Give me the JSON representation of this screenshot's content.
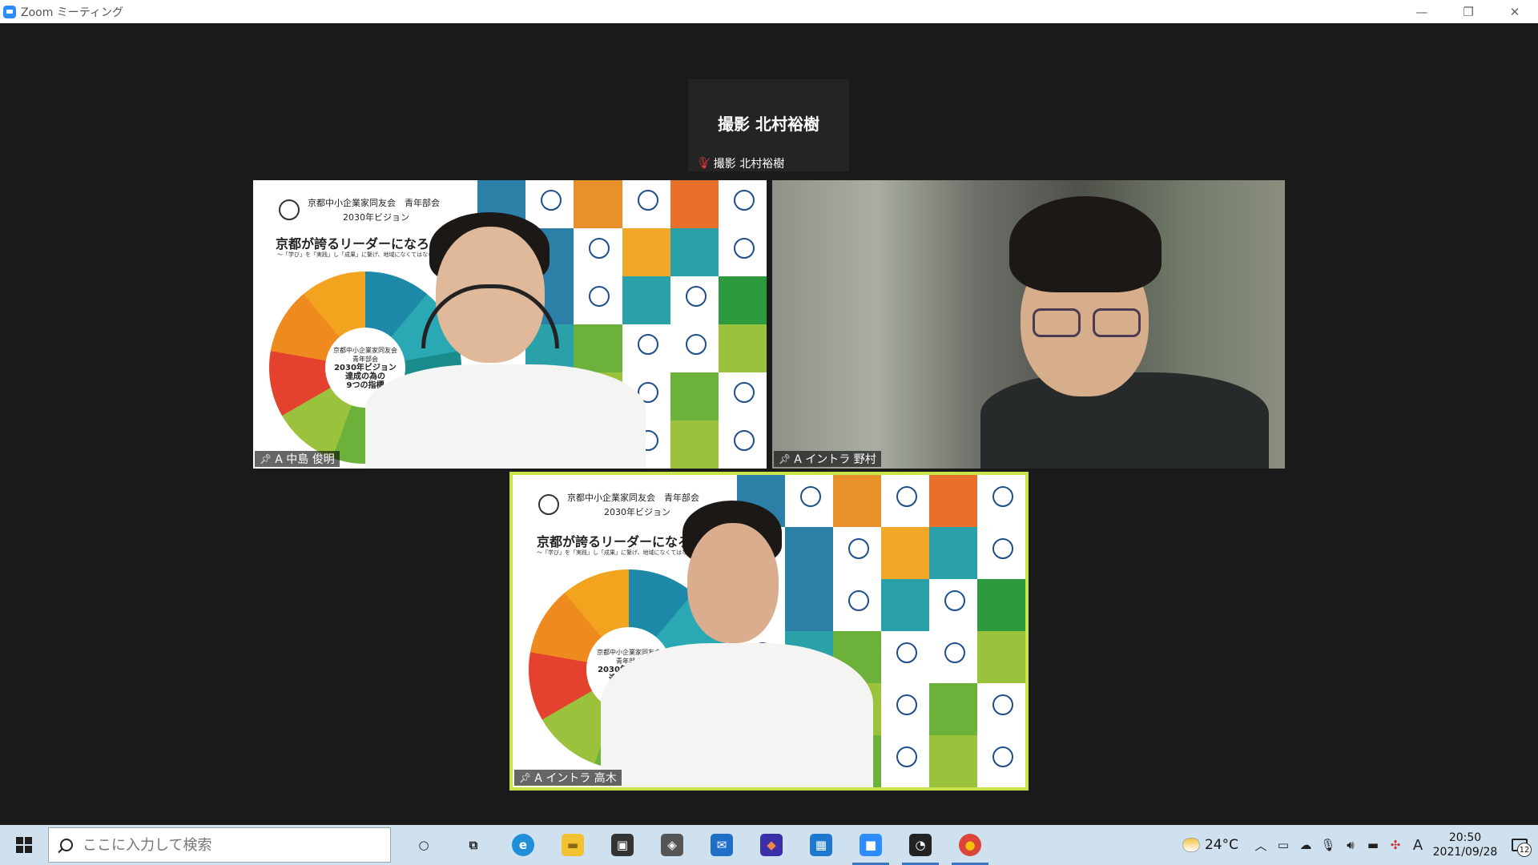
{
  "window": {
    "title": "Zoom ミーティング"
  },
  "participants": [
    {
      "id": "top",
      "display_name": "撮影 北村裕樹",
      "tag": "撮影 北村裕樹",
      "muted": true
    },
    {
      "id": "p1",
      "tag": "A 中島 俊明"
    },
    {
      "id": "p2",
      "tag": "A イントラ 野村"
    },
    {
      "id": "p3",
      "tag": "A イントラ 高木"
    }
  ],
  "slide": {
    "org": "京都中小企業家同友会　青年部会",
    "vision": "2030年ビジョン",
    "slogan": "京都が誇るリーダーになろう",
    "sub": "〜「学び」を「実践」し「成果」に繋げ、地域になくてはならない経営者へ〜",
    "hub_lines": [
      "京都中小企業家同友会",
      "青年部会",
      "2030年ビジョン",
      "達成の為の",
      "9つの指標"
    ],
    "grid_colors": [
      "#2c7fa6",
      "#ffffff",
      "#e8912a",
      "#ffffff",
      "#e8702a",
      "#ffffff",
      "#ffffff",
      "#2c7fa6",
      "#ffffff",
      "#f0a72a",
      "#2aa0a8",
      "#ffffff",
      "#ffffff",
      "#2c7fa6",
      "#ffffff",
      "#2aa0a8",
      "#ffffff",
      "#2e9a3e",
      "#ffffff",
      "#2aa0a8",
      "#6bb13a",
      "#ffffff",
      "#ffffff",
      "#9ac23c"
    ]
  },
  "taskbar": {
    "search_placeholder": "ここに入力して検索",
    "apps": [
      {
        "name": "cortana-icon",
        "glyph": "○",
        "color": "transparent",
        "text_color": "#222"
      },
      {
        "name": "task-view-icon",
        "glyph": "⧉",
        "color": "transparent",
        "text_color": "#222"
      },
      {
        "name": "edge-icon",
        "glyph": "e",
        "color": "#1f8fd8",
        "text_color": "#fff"
      },
      {
        "name": "file-explorer-icon",
        "glyph": "▬",
        "color": "#f2c230",
        "text_color": "#8a6a10"
      },
      {
        "name": "store-icon",
        "glyph": "▣",
        "color": "#333333",
        "text_color": "#fff"
      },
      {
        "name": "app-icon",
        "glyph": "◈",
        "color": "#555555",
        "text_color": "#fff"
      },
      {
        "name": "mail-icon",
        "glyph": "✉",
        "color": "#1f6fc8",
        "text_color": "#fff"
      },
      {
        "name": "colorful-app-icon",
        "glyph": "◆",
        "color": "#3a2fa8",
        "text_color": "#e84"
      },
      {
        "name": "calculator-icon",
        "glyph": "▦",
        "color": "#1e78d0",
        "text_color": "#fff"
      },
      {
        "name": "zoom-icon",
        "glyph": "■",
        "color": "#2d8cff",
        "text_color": "#fff"
      },
      {
        "name": "hangouts-icon",
        "glyph": "◔",
        "color": "#222222",
        "text_color": "#fff"
      },
      {
        "name": "chrome-icon",
        "glyph": "●",
        "color": "#db4437",
        "text_color": "#f4c20d"
      }
    ],
    "temperature": "24°C",
    "ime": "A",
    "time": "20:50",
    "date": "2021/09/28",
    "notification_count": "12"
  }
}
